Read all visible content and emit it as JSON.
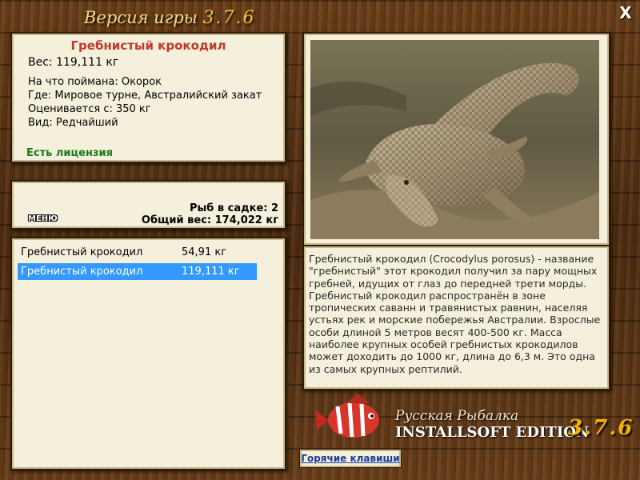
{
  "window": {
    "title": "Версия игры",
    "version": "3.7.6",
    "close_label": "X"
  },
  "catch": {
    "name": "Гребнистый крокодил",
    "weight": "Вес: 119,111 кг",
    "caught_with": "На что поймана: Окорок",
    "location": "Где: Мировое турне, Австралийский закат",
    "valued_from": "Оценивается с: 350 кг",
    "rarity": "Вид: Редчайший",
    "license": "Есть лицензия"
  },
  "cage": {
    "menu_label": "МЕНЮ",
    "fish_count": "Рыб в садке: 2",
    "total_weight": "Общий вес: 174,022 кг"
  },
  "fish_list": [
    {
      "name": "Гребнистый крокодил",
      "weight": "54,91 кг",
      "selected": false
    },
    {
      "name": "Гребнистый крокодил",
      "weight": "119,111 кг",
      "selected": true
    }
  ],
  "description": "Гребнистый крокодил (Crocodylus porosus) - название \"гребнистый\" этот крокодил получил за пару мощных гребней, идущих от глаз до передней трети морды. Гребнистый крокодил распространён в зоне тропических саванн и травянистых равнин, населяя устьях рек и морские побережья Австралии. Взрослые особи длиной 5 метров весят 400-500 кг. Масса наиболее крупных особей гребнистых крокодилов может доходить до 1000 кг, длина до 6,3 м. Это одна из самых крупных рептилий.",
  "logo": {
    "line1": "Русская Рыбалка",
    "line2": "INSTALLSOFT EDITION",
    "version": "3.7.6"
  },
  "hotkeys_label": "Горячие клавиши",
  "icons": {
    "photo": "crocodile-photo",
    "logo_fish": "red-striped-fish-icon",
    "close": "close-icon"
  }
}
